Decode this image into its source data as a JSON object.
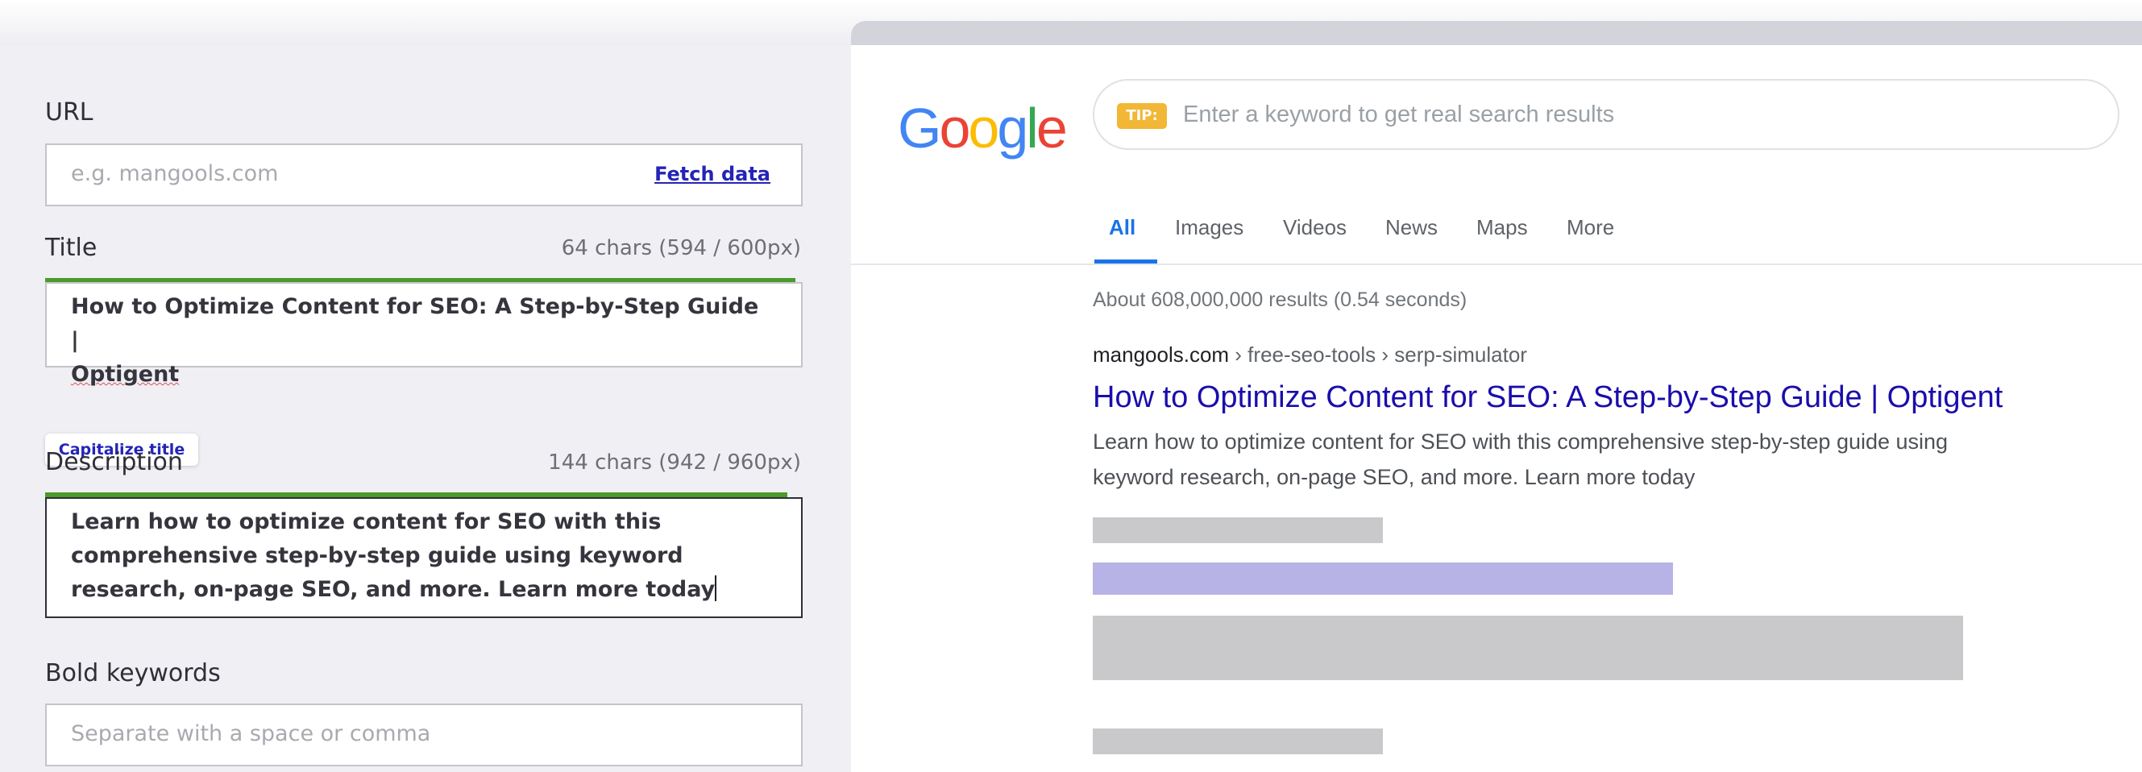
{
  "form": {
    "url": {
      "label": "URL",
      "placeholder": "e.g. mangools.com",
      "fetch_label": "Fetch data"
    },
    "title": {
      "label": "Title",
      "count": "64 chars (594 / 600px)",
      "value_part1": "How to Optimize Content for SEO: A Step-by-Step Guide |",
      "value_part2": "Optigent",
      "progress": 0.99,
      "capitalize_label": "Capitalize title"
    },
    "description": {
      "label": "Description",
      "count": "144 chars (942 / 960px)",
      "value": "Learn how to optimize content for SEO with this comprehensive step-by-step guide using keyword research, on-page SEO, and more. Learn more today",
      "progress": 0.98
    },
    "bold_keywords": {
      "label": "Bold keywords",
      "placeholder": "Separate with a space or comma"
    }
  },
  "serp": {
    "logo_letters": [
      "G",
      "o",
      "o",
      "g",
      "l",
      "e"
    ],
    "logo_colors": [
      "#4285F4",
      "#EA4335",
      "#FBBC05",
      "#4285F4",
      "#34A853",
      "#EA4335"
    ],
    "tip_label": "TIP:",
    "search_placeholder": "Enter a keyword to get real search results",
    "tabs": [
      "All",
      "Images",
      "Videos",
      "News",
      "Maps",
      "More"
    ],
    "active_tab": "All",
    "stats": "About 608,000,000 results (0.54 seconds)",
    "result": {
      "site": "mangools.com",
      "path": " › free-seo-tools › serp-simulator",
      "title": "How to Optimize Content for SEO: A Step-by-Step Guide | Optigent",
      "snippet_line1": "Learn how to optimize content for SEO with this comprehensive step-by-step guide using",
      "snippet_line2": "keyword research, on-page SEO, and more. Learn more today"
    },
    "colors": {
      "link": "#1a0dab",
      "active_tab": "#1a73e8",
      "tip": "#f2b736",
      "placeholder_bar": "#c9c9cc",
      "placeholder_title_bar": "#b7b3e6",
      "progress_bar": "#4a9a2c"
    }
  }
}
